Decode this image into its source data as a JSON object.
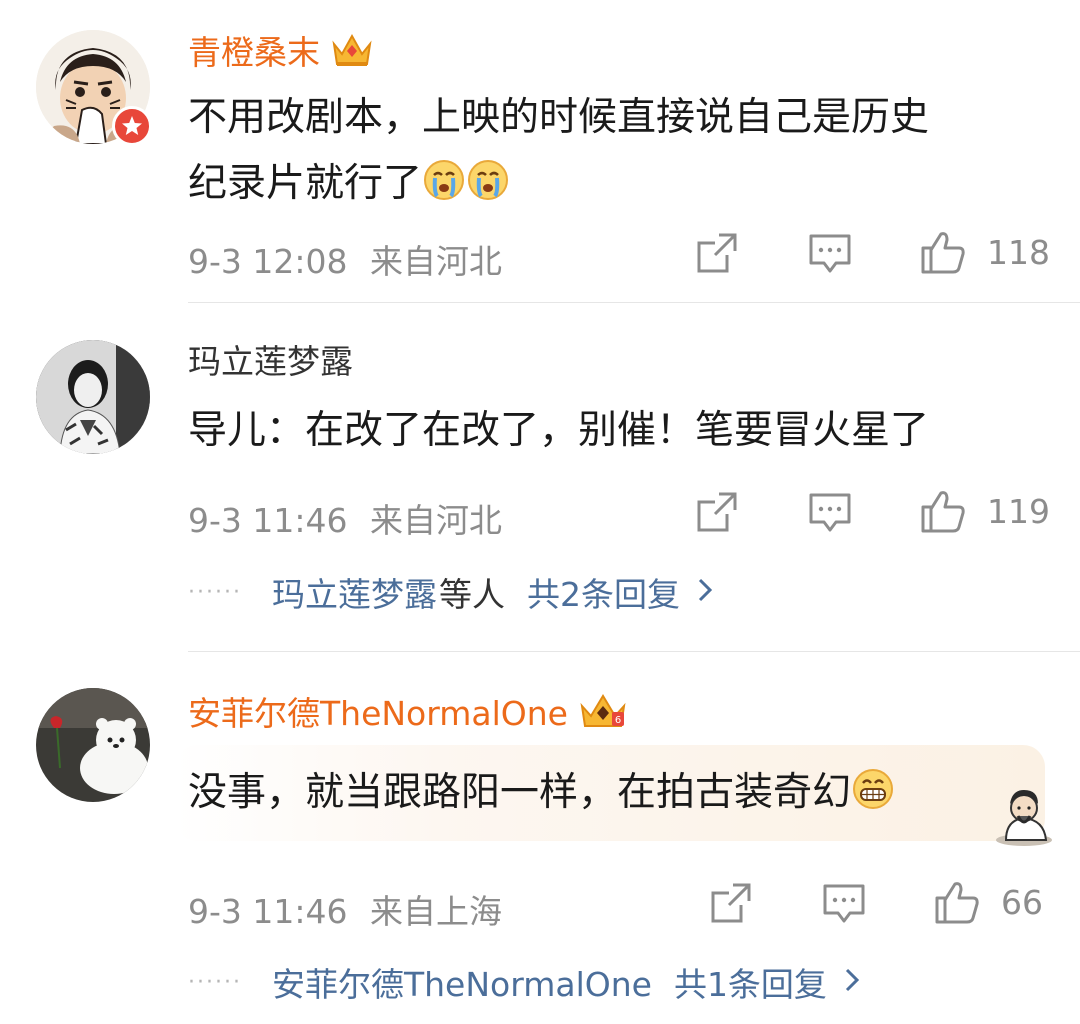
{
  "comments": [
    {
      "username": "青橙桑末",
      "text_line1": "不用改剧本，上映的时候直接说自己是历史",
      "text_line2": "纪录片就行了",
      "emojis": [
        "crying-face-icon",
        "crying-face-icon"
      ],
      "time": "9-3 12:08",
      "location": "来自河北",
      "likes": "118"
    },
    {
      "username": "玛立莲梦露",
      "text": "导儿：在改了在改了，别催！笔要冒火星了",
      "time": "9-3 11:46",
      "location": "来自河北",
      "likes": "119",
      "reply_names": "玛立莲梦露",
      "reply_suffix": "等人",
      "reply_count": "共2条回复"
    },
    {
      "username": "安菲尔德TheNormalOne",
      "text": "没事，就当跟路阳一样，在拍古装奇幻",
      "time": "9-3 11:46",
      "location": "来自上海",
      "likes": "66",
      "reply_names": "安菲尔德TheNormalOne",
      "reply_count": "共1条回复"
    }
  ],
  "colors": {
    "vip_name": "#ec6a1a",
    "link_blue": "#4b6e9a",
    "meta_gray": "#8c8c8c"
  }
}
